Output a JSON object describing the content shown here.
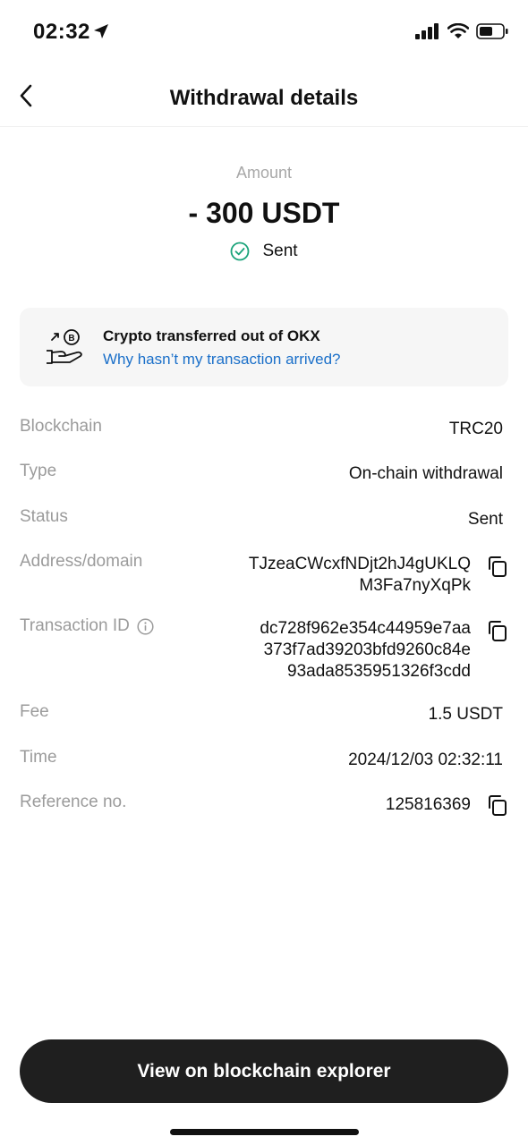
{
  "status_bar": {
    "time": "02:32"
  },
  "nav": {
    "title": "Withdrawal details"
  },
  "amount": {
    "label": "Amount",
    "value": "- 300 USDT",
    "status": "Sent"
  },
  "card": {
    "title": "Crypto transferred out of OKX",
    "link": "Why hasn’t my transaction arrived?"
  },
  "details": {
    "blockchain": {
      "label": "Blockchain",
      "value": "TRC20"
    },
    "type": {
      "label": "Type",
      "value": "On-chain withdrawal"
    },
    "status": {
      "label": "Status",
      "value": "Sent"
    },
    "address": {
      "label": "Address/domain",
      "line1": "TJzeaCWcxfNDjt2hJ4gUKLQ",
      "line2": "M3Fa7nyXqPk"
    },
    "txid": {
      "label": "Transaction ID",
      "line1": "dc728f962e354c44959e7aa",
      "line2": "373f7ad39203bfd9260c84e",
      "line3": "93ada8535951326f3cdd"
    },
    "fee": {
      "label": "Fee",
      "value": "1.5 USDT"
    },
    "time": {
      "label": "Time",
      "value": "2024/12/03 02:32:11"
    },
    "reference": {
      "label": "Reference no.",
      "value": "125816369"
    }
  },
  "footer": {
    "button_label": "View on blockchain explorer"
  },
  "colors": {
    "success": "#1aa37a",
    "link": "#1a6fc9",
    "button_bg": "#1f1f1f"
  }
}
